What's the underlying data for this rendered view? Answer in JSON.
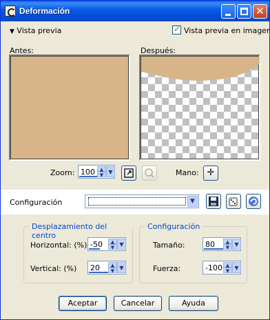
{
  "window": {
    "title": "Deformación"
  },
  "preview_section": {
    "toggle_label": "Vista previa",
    "in_image_label": "Vista previa en imagen",
    "in_image_checked": true,
    "before_label": "Antes:",
    "after_label": "Después:",
    "before_color": "#d8b589",
    "zoom_label": "Zoom:",
    "zoom_value": "100",
    "hand_label": "Mano:"
  },
  "config_row": {
    "label": "Configuración",
    "preset_value": ""
  },
  "center_group": {
    "title": "Desplazamiento del centro",
    "horizontal_label": "Horizontal: (%)",
    "horizontal_value": "-50",
    "vertical_label": "Vertical: (%)",
    "vertical_value": "20"
  },
  "settings_group": {
    "title": "Configuración",
    "size_label": "Tamaño:",
    "size_value": "80",
    "strength_label": "Fuerza:",
    "strength_value": "-100"
  },
  "buttons": {
    "ok": "Aceptar",
    "cancel": "Cancelar",
    "help": "Ayuda"
  },
  "colors": {
    "titlebar": "#0b5dea",
    "accent": "#0046d5",
    "background": "#ece9d8"
  }
}
